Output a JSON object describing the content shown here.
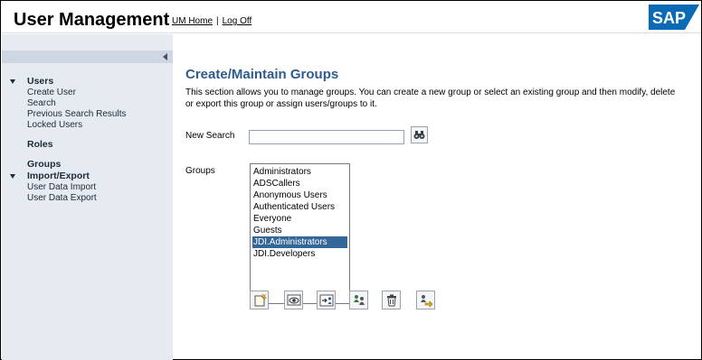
{
  "header": {
    "title": "User Management",
    "links": {
      "home": "UM Home",
      "separator": "|",
      "logoff": "Log Off"
    },
    "logo_text": "SAP"
  },
  "sidebar": {
    "collapse_icon": "chevron-left-icon",
    "sections": [
      {
        "label": "Users",
        "items": [
          "Create User",
          "Search",
          "Previous Search Results",
          "Locked Users"
        ]
      },
      {
        "label": "Roles"
      },
      {
        "label": "Groups"
      },
      {
        "label": "Import/Export",
        "items": [
          "User Data Import",
          "User Data Export"
        ]
      }
    ]
  },
  "main": {
    "title": "Create/Maintain Groups",
    "description": "This section allows you to manage groups. You can create a new group or select an existing group and then modify, delete or export this group or assign users/groups to it.",
    "new_search_label": "New Search",
    "search_value": "",
    "groups_label": "Groups",
    "groups": [
      "Administrators",
      "ADSCallers",
      "Anonymous Users",
      "Authenticated Users",
      "Everyone",
      "Guests",
      "JDI.Administrators",
      "JDI.Developers"
    ],
    "selected_group": "JDI.Administrators",
    "actions": [
      "create-icon",
      "view-icon",
      "assign-icon",
      "edit-icon",
      "delete-icon",
      "export-icon"
    ]
  },
  "colors": {
    "title_blue": "#2f5c8f",
    "sidebar_bg": "#e6ebf2",
    "selection": "#336699",
    "sap_logo": "#0a6ab5"
  }
}
